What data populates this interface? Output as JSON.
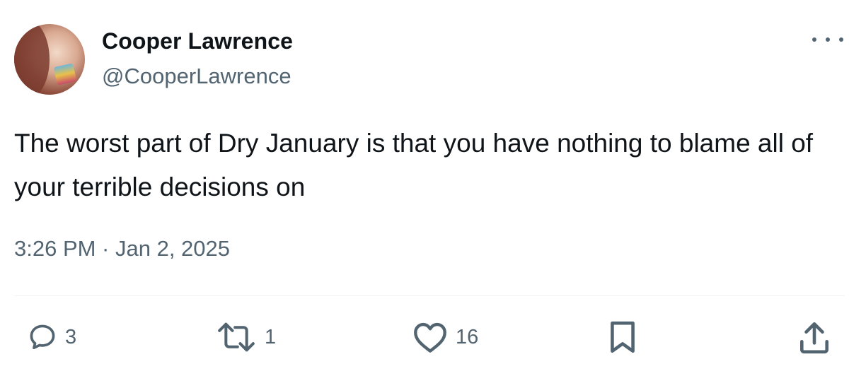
{
  "user": {
    "display_name": "Cooper Lawrence",
    "handle": "@CooperLawrence",
    "avatar_icon": "profile-photo"
  },
  "tweet": {
    "text": "The worst part of Dry January is that you have nothing to blame all of your terrible decisions on",
    "timestamp": "3:26 PM · Jan 2, 2025"
  },
  "actions": {
    "replies": "3",
    "reposts": "1",
    "likes": "16"
  },
  "icons": {
    "more": "more-horizontal-icon",
    "reply": "reply-icon",
    "repost": "repost-icon",
    "like": "heart-icon",
    "bookmark": "bookmark-icon",
    "share": "share-icon"
  },
  "colors": {
    "text_primary": "#0f1419",
    "text_secondary": "#536471",
    "divider": "#eff3f4"
  }
}
